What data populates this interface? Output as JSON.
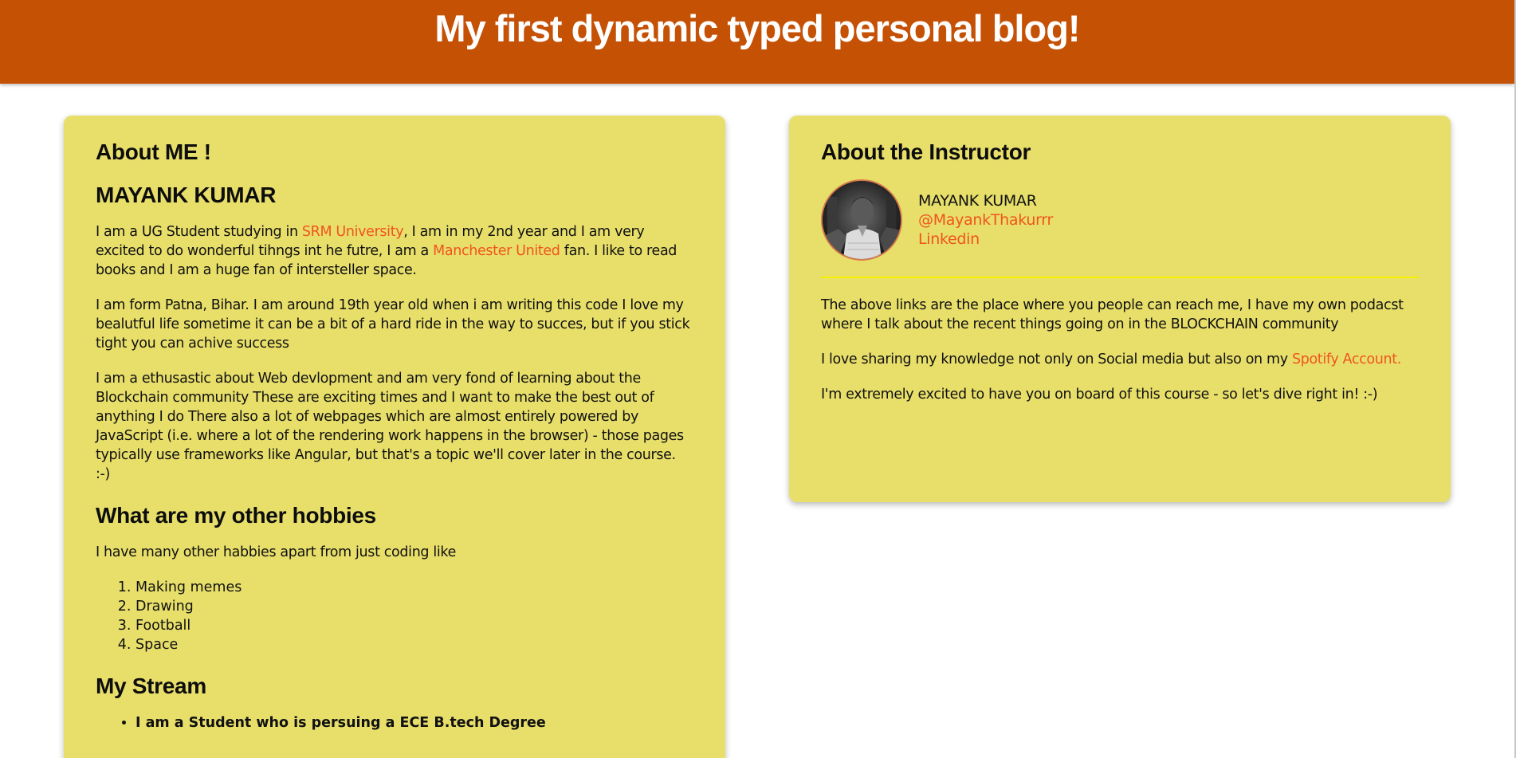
{
  "header": {
    "title": "My first dynamic typed personal blog!"
  },
  "about_me": {
    "heading": "About ME !",
    "name": "MAYANK KUMAR",
    "p1_a": "I am a UG Student studying in ",
    "p1_link1": "SRM University",
    "p1_b": ", I am in my 2nd year and I am very excited to do wonderful tihngs int he futre, I am a ",
    "p1_link2": "Manchester United",
    "p1_c": " fan. I like to read books and I am a huge fan of intersteller space.",
    "p2": "I am form Patna, Bihar. I am around 19th year old when i am writing this code I love my bealutful life sometime it can be a bit of a hard ride in the way to succes, but if you stick tight you can achive success",
    "p3": "I am a ethusastic about Web devlopment and am very fond of learning about the Blockchain community These are exciting times and I want to make the best out of anything I do There also a lot of webpages which are almost entirely powered by JavaScript (i.e. where a lot of the rendering work happens in the browser) - those pages typically use frameworks like Angular, but that's a topic we'll cover later in the course. :-)",
    "hobbies_heading": "What are my other hobbies",
    "hobbies_intro": "I have many other habbies apart from just coding like",
    "hobbies": [
      "Making memes",
      "Drawing",
      "Football",
      "Space"
    ],
    "stream_heading": "My Stream",
    "stream_items": [
      "I am a Student who is persuing a ECE B.tech Degree"
    ]
  },
  "instructor": {
    "heading": "About the Instructor",
    "name": "MAYANK KUMAR",
    "handle": "@MayankThakurrr",
    "linkedin": "Linkedin",
    "p1": "The above links are the place where you people can reach me, I have my own podacst where I talk about the recent things going on in the BLOCKCHAIN community",
    "p2_a": "I love sharing my knowledge not only on Social media but also on my ",
    "p2_link": "Spotify Account.",
    "p3": "I'm extremely excited to have you on board of this course - so let's dive right in! :-)"
  },
  "colors": {
    "header_bg": "#c55105",
    "card_bg": "#e8df6b",
    "link": "#f0541e",
    "divider": "#f5f000"
  }
}
